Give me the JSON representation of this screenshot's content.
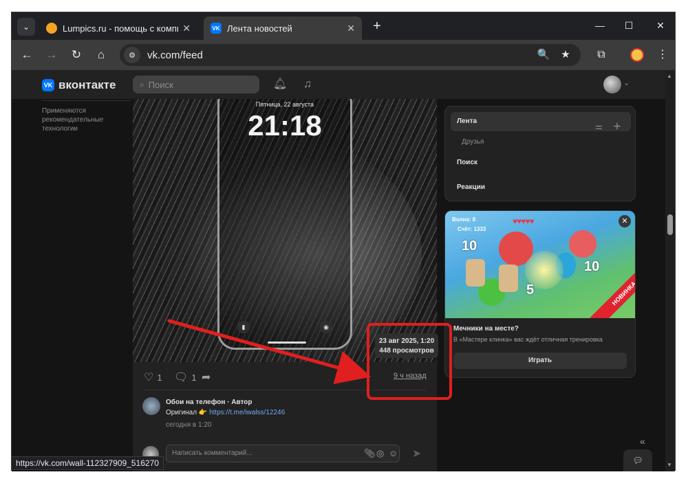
{
  "browser": {
    "tabs": [
      {
        "title": "Lumpics.ru - помощь с компь",
        "icon": "orange-circle-icon"
      },
      {
        "title": "Лента новостей",
        "icon": "vk-icon"
      }
    ],
    "url": "vk.com/feed",
    "status_url": "https://vk.com/wall-112327909_516270"
  },
  "vk": {
    "logo": "вконтакте",
    "search_placeholder": "Поиск",
    "left_note": "Применяются рекомендательные технологии"
  },
  "post": {
    "lock_date": "Пятница, 22 августа",
    "lock_time": "21:18",
    "likes": "1",
    "comments": "1",
    "time_ago": "9 ч назад",
    "tooltip_date": "23 авг 2025, 1:20",
    "tooltip_views": "448 просмотров",
    "comment": {
      "author": "Обои на телефон · Автор",
      "text_prefix": "Оригинал 👉 ",
      "link": "https://t.me/iwalss/12246",
      "time": "сегодня в 1:20"
    },
    "write_placeholder": "Написать комментарий..."
  },
  "right_menu": {
    "items": [
      "Лента",
      "Друзья",
      "Поиск",
      "Реакции"
    ]
  },
  "ad": {
    "wave": "Волна: 8",
    "score": "Счёт: 1333",
    "numbers": [
      "10",
      "10",
      "5"
    ],
    "new_badge": "НОВИНКА",
    "title": "Мечники на месте?",
    "desc": "В «Мастере клинка» вас ждёт отличная тренировка",
    "button": "Играть"
  },
  "colors": {
    "accent": "#0077ff",
    "annotation": "#e01f1f"
  }
}
